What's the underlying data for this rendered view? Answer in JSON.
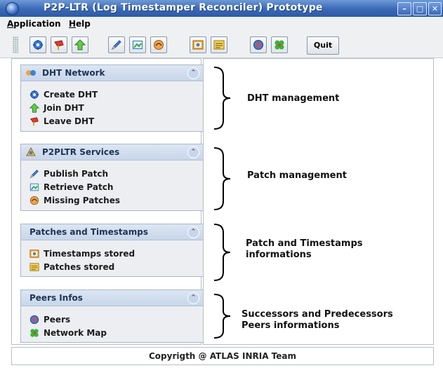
{
  "window": {
    "title": "P2P-LTR (Log Timestamper Reconciler) Prototype"
  },
  "menu": {
    "application": {
      "mnemonic": "A",
      "rest": "pplication"
    },
    "help": {
      "mnemonic": "H",
      "rest": "elp"
    }
  },
  "toolbar": {
    "quit_label": "Quit",
    "icons": [
      "create-dht-icon",
      "leave-dht-icon",
      "join-dht-icon",
      "publish-patch-icon",
      "retrieve-patch-icon",
      "missing-patches-icon",
      "timestamps-icon",
      "patches-icon",
      "peers-icon",
      "network-map-icon"
    ]
  },
  "panels": {
    "dht": {
      "title": "DHT Network",
      "items": [
        "Create DHT",
        "Join DHT",
        "Leave DHT"
      ]
    },
    "services": {
      "title": "P2PLTR Services",
      "items": [
        "Publish Patch",
        "Retrieve Patch",
        "Missing Patches"
      ]
    },
    "patches": {
      "title": "Patches and Timestamps",
      "items": [
        "Timestamps stored",
        "Patches stored"
      ]
    },
    "peers": {
      "title": "Peers Infos",
      "items": [
        "Peers",
        "Network Map"
      ]
    }
  },
  "annotations": {
    "dht": "DHT management",
    "patch": "Patch management",
    "timestamps_line1": "Patch and Timestamps",
    "timestamps_line2": "informations",
    "peers_line1": "Successors and Predecessors",
    "peers_line2": "Peers informations"
  },
  "footer": "Copyrigth @ ATLAS INRIA Team",
  "colors": {
    "titlebar": "#3a68b5",
    "panel_header": "#c8d6ea",
    "panel_title": "#1d3456"
  }
}
